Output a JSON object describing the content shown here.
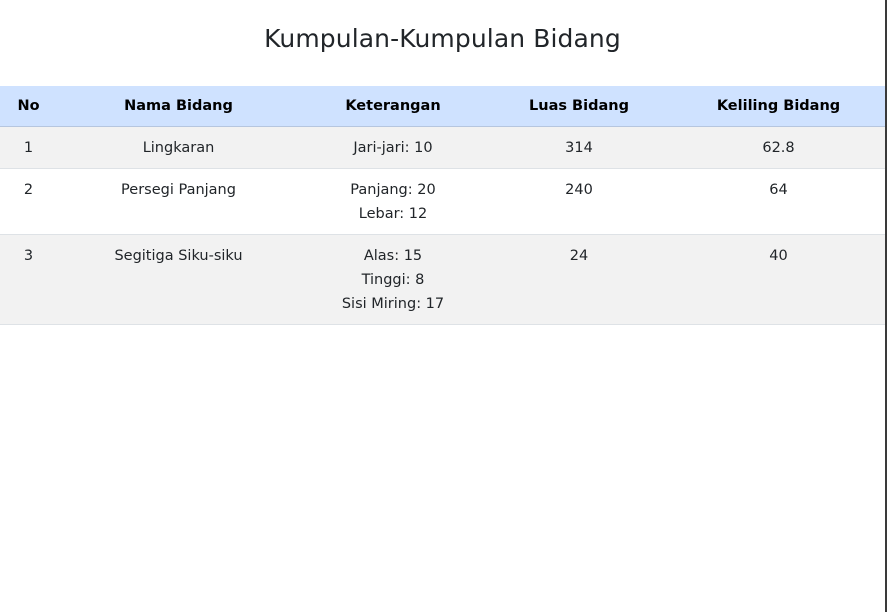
{
  "page": {
    "title": "Kumpulan-Kumpulan Bidang"
  },
  "table": {
    "headers": [
      "No",
      "Nama Bidang",
      "Keterangan",
      "Luas Bidang",
      "Keliling Bidang"
    ],
    "rows": [
      {
        "no": "1",
        "name": "Lingkaran",
        "description": [
          "Jari-jari: 10"
        ],
        "area": "314",
        "perimeter": "62.8"
      },
      {
        "no": "2",
        "name": "Persegi Panjang",
        "description": [
          "Panjang: 20",
          "Lebar: 12"
        ],
        "area": "240",
        "perimeter": "64"
      },
      {
        "no": "3",
        "name": "Segitiga Siku-siku",
        "description": [
          "Alas: 15",
          "Tinggi: 8",
          "Sisi Miring: 17"
        ],
        "area": "24",
        "perimeter": "40"
      }
    ]
  },
  "colors": {
    "header_background": "#cfe2ff",
    "striped_row": "#f2f2f2",
    "text": "#212529"
  }
}
